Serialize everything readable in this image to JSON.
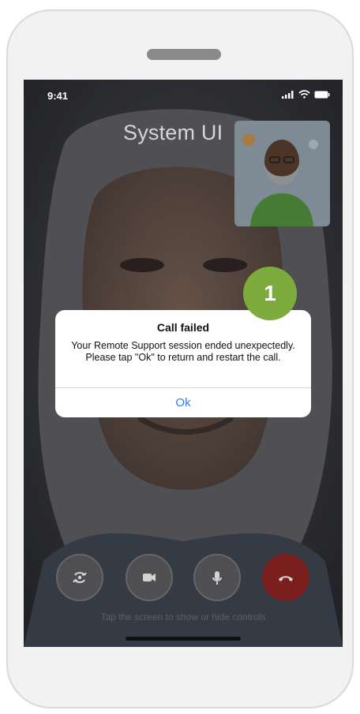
{
  "status_bar": {
    "time": "9:41"
  },
  "header": {
    "title": "System UI"
  },
  "step_badge": {
    "number": "1"
  },
  "dialog": {
    "title": "Call failed",
    "message": "Your Remote Support session ended unexpectedly. Please tap \"Ok\" to return and restart the call.",
    "ok_label": "Ok"
  },
  "controls": {
    "switch_camera_icon": "camera-switch-icon",
    "video_icon": "video-camera-icon",
    "mic_icon": "microphone-icon",
    "end_call_icon": "end-call-icon"
  },
  "hint": {
    "text": "Tap the screen to show or hide controls"
  },
  "colors": {
    "accent_badge": "#7dab3c",
    "dialog_action": "#2f7cf6",
    "end_call": "#7a1e1e"
  }
}
